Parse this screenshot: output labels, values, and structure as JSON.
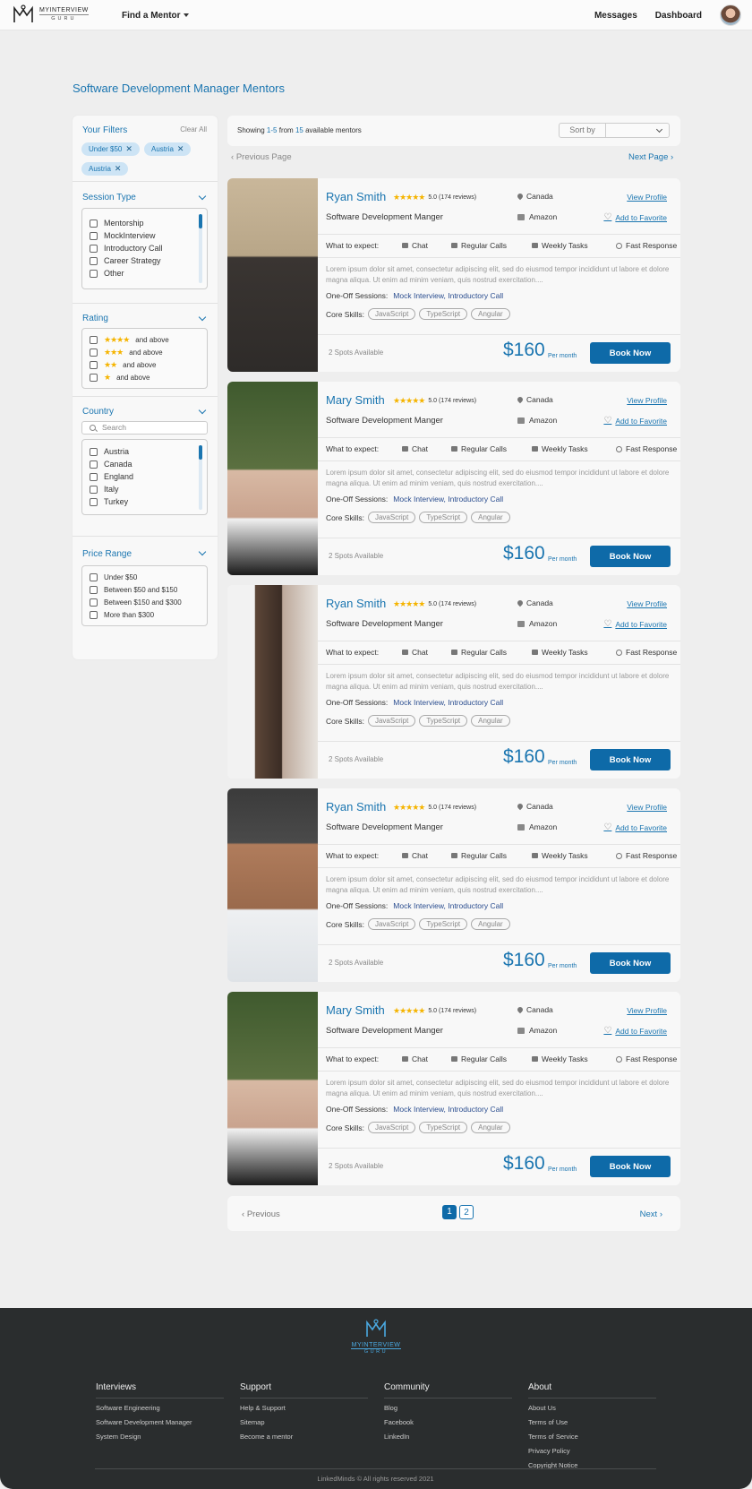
{
  "header": {
    "logo_text": "MYINTERVIEW",
    "logo_sub": "GURU",
    "nav_find": "Find a Mentor",
    "nav_messages": "Messages",
    "nav_dashboard": "Dashboard"
  },
  "page_title": "Software Development Manager Mentors",
  "filters": {
    "title": "Your Filters",
    "clear": "Clear All",
    "chips": [
      "Under $50",
      "Austria",
      "Austria"
    ],
    "session_type": {
      "title": "Session Type",
      "options": [
        "Mentorship",
        "MockInterview",
        "Introductory  Call",
        "Career Strategy",
        "Other"
      ]
    },
    "rating": {
      "title": "Rating",
      "options": [
        {
          "stars": "★★★★",
          "label": "and above"
        },
        {
          "stars": "★★★",
          "label": "and above"
        },
        {
          "stars": "★★",
          "label": "and above"
        },
        {
          "stars": "★",
          "label": "and above"
        }
      ]
    },
    "country": {
      "title": "Country",
      "search_placeholder": "Search",
      "options": [
        "Austria",
        "Canada",
        "England",
        "Italy",
        "Turkey"
      ]
    },
    "price": {
      "title": "Price Range",
      "options": [
        "Under $50",
        "Between $50 and $150",
        "Between $150 and $300",
        "More than $300"
      ]
    }
  },
  "results": {
    "showing_prefix": "Showing",
    "showing_range": "1-5",
    "showing_from": "from",
    "showing_total": "15",
    "showing_suffix": "available mentors",
    "sort_label": "Sort by",
    "prev_page": "Previous Page",
    "next_page": "Next Page"
  },
  "card_labels": {
    "view_profile": "View Profile",
    "add_favorite": "Add to Favorite",
    "what_to_expect": "What to expect:",
    "expect_items": [
      "Chat",
      "Regular Calls",
      "Weekly Tasks",
      "Fast Response"
    ],
    "one_off": "One-Off Sessions:",
    "core_skills": "Core Skills:",
    "per_month": "Per month",
    "book_now": "Book Now"
  },
  "mentors": [
    {
      "name": "Ryan Smith",
      "stars": "★★★★★",
      "rating": "5.0 (174 reviews)",
      "location": "Canada",
      "title": "Software Development Manger",
      "company": "Amazon",
      "description": "Lorem ipsum dolor sit amet, consectetur adipiscing elit, sed do eiusmod tempor incididunt ut labore et dolore magna aliqua. Ut enim ad minim veniam, quis nostrud exercitation....",
      "sessions": "Mock Interview, Introductory Call",
      "skills": [
        "JavaScript",
        "TypeScript",
        "Angular"
      ],
      "spots": "2 Spots Available",
      "price": "$160",
      "photo": "young man with glasses and vest"
    },
    {
      "name": "Mary Smith",
      "stars": "★★★★★",
      "rating": "5.0 (174 reviews)",
      "location": "Canada",
      "title": "Software Development Manger",
      "company": "Amazon",
      "description": "Lorem ipsum dolor sit amet, consectetur adipiscing elit, sed do eiusmod tempor incididunt ut labore et dolore magna aliqua. Ut enim ad minim veniam, quis nostrud exercitation....",
      "sessions": "Mock Interview, Introductory Call",
      "skills": [
        "JavaScript",
        "TypeScript",
        "Angular"
      ],
      "spots": "2 Spots Available",
      "price": "$160",
      "photo": "woman with dark hair"
    },
    {
      "name": "Ryan Smith",
      "stars": "★★★★★",
      "rating": "5.0 (174 reviews)",
      "location": "Canada",
      "title": "Software Development Manger",
      "company": "Amazon",
      "description": "Lorem ipsum dolor sit amet, consectetur adipiscing elit, sed do eiusmod tempor incididunt ut labore et dolore magna aliqua. Ut enim ad minim veniam, quis nostrud exercitation....",
      "sessions": "Mock Interview, Introductory Call",
      "skills": [
        "JavaScript",
        "TypeScript",
        "Angular"
      ],
      "spots": "2 Spots Available",
      "price": "$160",
      "photo": "bearded man in profile"
    },
    {
      "name": "Ryan Smith",
      "stars": "★★★★★",
      "rating": "5.0 (174 reviews)",
      "location": "Canada",
      "title": "Software Development Manger",
      "company": "Amazon",
      "description": "Lorem ipsum dolor sit amet, consectetur adipiscing elit, sed do eiusmod tempor incididunt ut labore et dolore magna aliqua. Ut enim ad minim veniam, quis nostrud exercitation....",
      "sessions": "Mock Interview, Introductory Call",
      "skills": [
        "JavaScript",
        "TypeScript",
        "Angular"
      ],
      "spots": "2 Spots Available",
      "price": "$160",
      "photo": "smiling man in white shirt"
    },
    {
      "name": "Mary Smith",
      "stars": "★★★★★",
      "rating": "5.0 (174 reviews)",
      "location": "Canada",
      "title": "Software Development Manger",
      "company": "Amazon",
      "description": "Lorem ipsum dolor sit amet, consectetur adipiscing elit, sed do eiusmod tempor incididunt ut labore et dolore magna aliqua. Ut enim ad minim veniam, quis nostrud exercitation....",
      "sessions": "Mock Interview, Introductory Call",
      "skills": [
        "JavaScript",
        "TypeScript",
        "Angular"
      ],
      "spots": "2 Spots Available",
      "price": "$160",
      "photo": "woman with dark hair"
    }
  ],
  "pagination": {
    "prev": "Previous",
    "pages": [
      "1",
      "2"
    ],
    "current": "1",
    "next": "Next"
  },
  "footer": {
    "logo_text": "MYINTERVIEW",
    "logo_sub": "GURU",
    "columns": [
      {
        "title": "Interviews",
        "links": [
          "Software Engineering",
          "Software Development Manager",
          "System Design"
        ]
      },
      {
        "title": "Support",
        "links": [
          "Help & Support",
          "Sitemap",
          "Become a mentor"
        ]
      },
      {
        "title": "Community",
        "links": [
          "Blog",
          "Facebook",
          "LinkedIn"
        ]
      },
      {
        "title": "About",
        "links": [
          "About Us",
          "Terms of Use",
          "Terms of Service",
          "Privacy Policy",
          "Copyright Notice"
        ]
      }
    ],
    "copyright": "LinkedMinds © All rights reserved 2021"
  },
  "colors": {
    "accent": "#1a75b0",
    "button": "#0e6aa8",
    "footer_bg": "#2a2d2e",
    "star": "#f5b400"
  }
}
